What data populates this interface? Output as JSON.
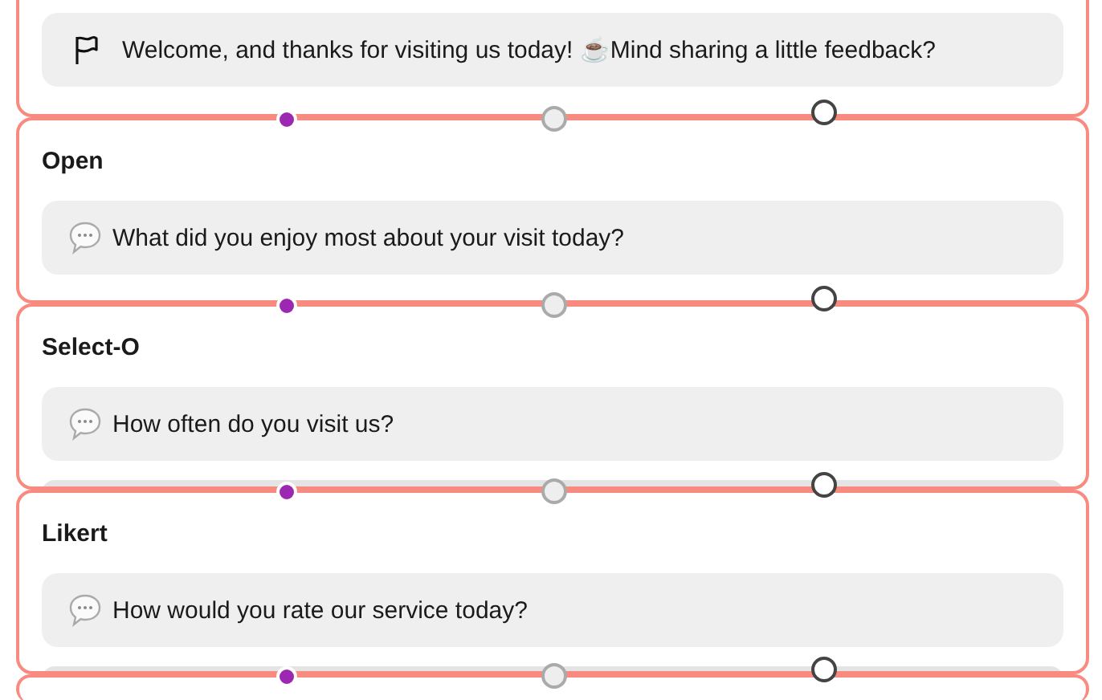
{
  "nodes": [
    {
      "kind": "welcome",
      "text": "Welcome, and thanks for visiting us today! ☕Mind sharing a little feedback?"
    },
    {
      "kind": "open",
      "title": "Open",
      "text": "What did you enjoy most about your visit today?"
    },
    {
      "kind": "select",
      "title": "Select-O",
      "text": "How often do you visit us?"
    },
    {
      "kind": "likert",
      "title": "Likert",
      "text": "How would you rate our service today?"
    },
    {
      "kind": "partial"
    }
  ]
}
